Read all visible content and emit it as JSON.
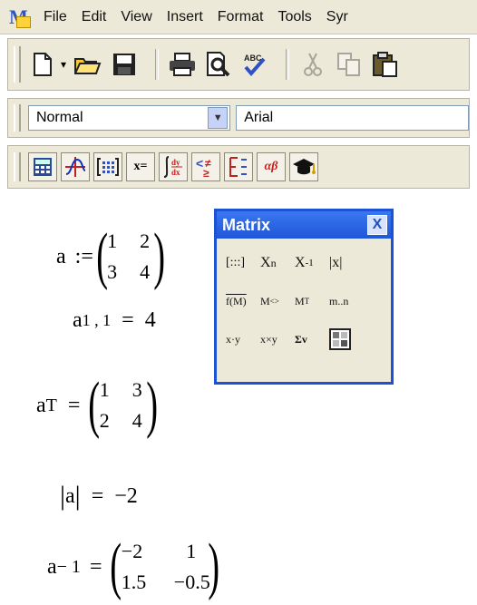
{
  "menubar": {
    "items": [
      "File",
      "Edit",
      "View",
      "Insert",
      "Format",
      "Tools",
      "Syr"
    ]
  },
  "icons": {
    "standard": [
      "new-document-icon",
      "open-folder-icon",
      "save-icon",
      "print-icon",
      "print-preview-icon",
      "spell-check-icon",
      "cut-icon",
      "copy-icon",
      "paste-icon"
    ],
    "math": [
      "calculator-icon",
      "graph-icon",
      "matrix-icon",
      "evaluation-icon",
      "calculus-icon",
      "boolean-icon",
      "programming-icon",
      "greek-icon",
      "symbolic-icon"
    ]
  },
  "formatting": {
    "style": "Normal",
    "font": "Arial"
  },
  "math_toolbar": {
    "eval_label": "x=",
    "greek_label": "αβ"
  },
  "worksheet": {
    "def": {
      "var": "a",
      "op": ":=",
      "cells": [
        "1",
        "2",
        "3",
        "4"
      ]
    },
    "elem": {
      "var": "a",
      "sub": "1 , 1",
      "op": "=",
      "value": "4"
    },
    "transpose": {
      "var": "a",
      "sup": "T",
      "op": "=",
      "cells": [
        "1",
        "3",
        "2",
        "4"
      ]
    },
    "det": {
      "var": "a",
      "op": "=",
      "value": "−2"
    },
    "inverse": {
      "var": "a",
      "sup": "− 1",
      "op": "=",
      "cells": [
        "−2",
        "1",
        "1.5",
        "−0.5"
      ]
    }
  },
  "palette": {
    "title": "Matrix",
    "close": "X",
    "buttons": [
      "[:::]",
      "X",
      "n",
      "X",
      "-1",
      "|x|",
      "f(M)",
      "M",
      "<>",
      "M",
      "T",
      "m..n",
      "x·y",
      "x×y",
      "Σv",
      "picture"
    ]
  }
}
